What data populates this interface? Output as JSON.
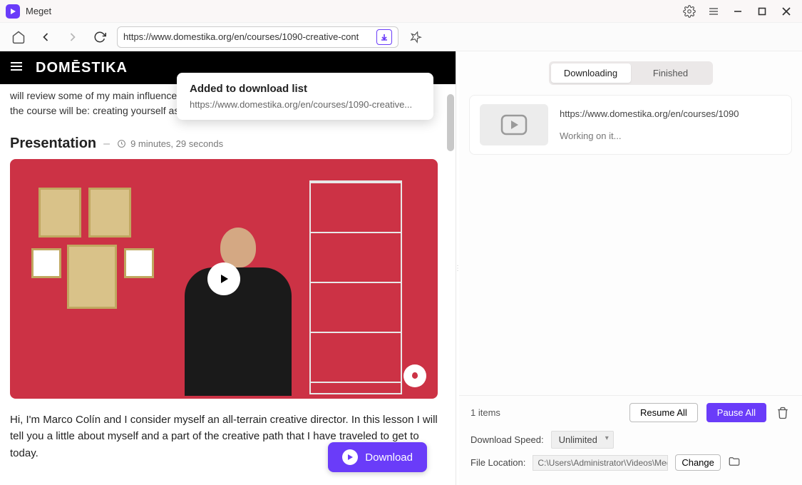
{
  "app": {
    "title": "Meget"
  },
  "toolbar": {
    "url": "https://www.domestika.org/en/courses/1090-creative-cont"
  },
  "page": {
    "logo": "DOMĒSTIKA",
    "intro": "will review some of my main influences. Finally, I will tell you about the objective that will govern the course will be: creating yourself as a creative.",
    "section_title": "Presentation",
    "duration": "9 minutes, 29 seconds",
    "transcript": "Hi, I'm Marco Colín and I consider myself an all-terrain creative director. In this lesson I will tell you a little about myself and a part of the creative path that I have traveled to get to today.",
    "download_btn": "Download"
  },
  "toast": {
    "title": "Added to download list",
    "url": "https://www.domestika.org/en/courses/1090-creative..."
  },
  "right": {
    "tabs": {
      "downloading": "Downloading",
      "finished": "Finished"
    },
    "item": {
      "url": "https://www.domestika.org/en/courses/1090",
      "status": "Working on it..."
    },
    "footer": {
      "count": "1 items",
      "resume": "Resume All",
      "pause": "Pause All",
      "speed_label": "Download Speed:",
      "speed_value": "Unlimited",
      "loc_label": "File Location:",
      "loc_value": "C:\\Users\\Administrator\\Videos\\Meget\\D",
      "change": "Change"
    }
  }
}
